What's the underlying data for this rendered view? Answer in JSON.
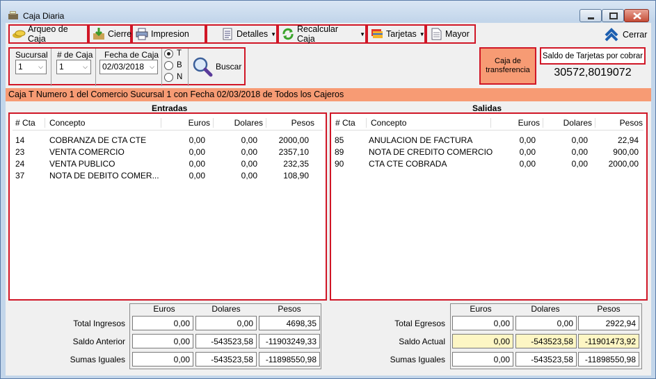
{
  "window": {
    "title": "Caja Diaria"
  },
  "toolbar": {
    "arqueo": "Arqueo de Caja",
    "cierre": "Cierre",
    "impresion": "Impresion",
    "detalles": "Detalles",
    "recalcular": "Recalcular Caja",
    "tarjetas": "Tarjetas",
    "mayor": "Mayor",
    "cerrar": "Cerrar"
  },
  "filters": {
    "sucursal_label": "Sucursal",
    "sucursal_value": "1",
    "caja_label": "# de Caja",
    "caja_value": "1",
    "fecha_label": "Fecha de Caja",
    "fecha_value": "02/03/2018",
    "radios": [
      {
        "label": "T",
        "checked": true
      },
      {
        "label": "B",
        "checked": false
      },
      {
        "label": "N",
        "checked": false
      }
    ],
    "buscar": "Buscar"
  },
  "caja_transferencia": {
    "line1": "Caja de",
    "line2": "transferencia"
  },
  "saldo_tarjetas": {
    "label": "Saldo de Tarjetas por cobrar",
    "value": "30572,8019072"
  },
  "banner": "Caja T Numero 1 del Comercio Sucursal 1 con Fecha 02/03/2018 de Todos los Cajeros",
  "entradas": {
    "title": "Entradas",
    "columns": [
      "# Cta",
      "Concepto",
      "Euros",
      "Dolares",
      "Pesos"
    ],
    "rows": [
      {
        "cta": "14",
        "concepto": "COBRANZA DE CTA CTE",
        "euros": "0,00",
        "dolares": "0,00",
        "pesos": "2000,00"
      },
      {
        "cta": "23",
        "concepto": "VENTA COMERCIO",
        "euros": "0,00",
        "dolares": "0,00",
        "pesos": "2357,10"
      },
      {
        "cta": "24",
        "concepto": "VENTA PUBLICO",
        "euros": "0,00",
        "dolares": "0,00",
        "pesos": "232,35"
      },
      {
        "cta": "37",
        "concepto": "NOTA DE DEBITO COMER...",
        "euros": "0,00",
        "dolares": "0,00",
        "pesos": "108,90"
      }
    ]
  },
  "salidas": {
    "title": "Salidas",
    "columns": [
      "# Cta",
      "Concepto",
      "Euros",
      "Dolares",
      "Pesos"
    ],
    "rows": [
      {
        "cta": "85",
        "concepto": "ANULACION DE FACTURA",
        "euros": "0,00",
        "dolares": "0,00",
        "pesos": "22,94"
      },
      {
        "cta": "89",
        "concepto": "NOTA DE CREDITO COMERCIO",
        "euros": "0,00",
        "dolares": "0,00",
        "pesos": "900,00"
      },
      {
        "cta": "90",
        "concepto": "CTA CTE COBRADA",
        "euros": "0,00",
        "dolares": "0,00",
        "pesos": "2000,00"
      }
    ]
  },
  "totals_left": {
    "headers": [
      "Euros",
      "Dolares",
      "Pesos"
    ],
    "rows": [
      {
        "label": "Total Ingresos",
        "euros": "0,00",
        "dolares": "0,00",
        "pesos": "4698,35"
      },
      {
        "label": "Saldo Anterior",
        "euros": "0,00",
        "dolares": "-543523,58",
        "pesos": "-11903249,33"
      },
      {
        "label": "Sumas Iguales",
        "euros": "0,00",
        "dolares": "-543523,58",
        "pesos": "-11898550,98"
      }
    ]
  },
  "totals_right": {
    "headers": [
      "Euros",
      "Dolares",
      "Pesos"
    ],
    "rows": [
      {
        "label": "Total Egresos",
        "euros": "0,00",
        "dolares": "0,00",
        "pesos": "2922,94"
      },
      {
        "label": "Saldo Actual",
        "euros": "0,00",
        "dolares": "-543523,58",
        "pesos": "-11901473,92"
      },
      {
        "label": "Sumas Iguales",
        "euros": "0,00",
        "dolares": "-543523,58",
        "pesos": "-11898550,98"
      }
    ]
  }
}
